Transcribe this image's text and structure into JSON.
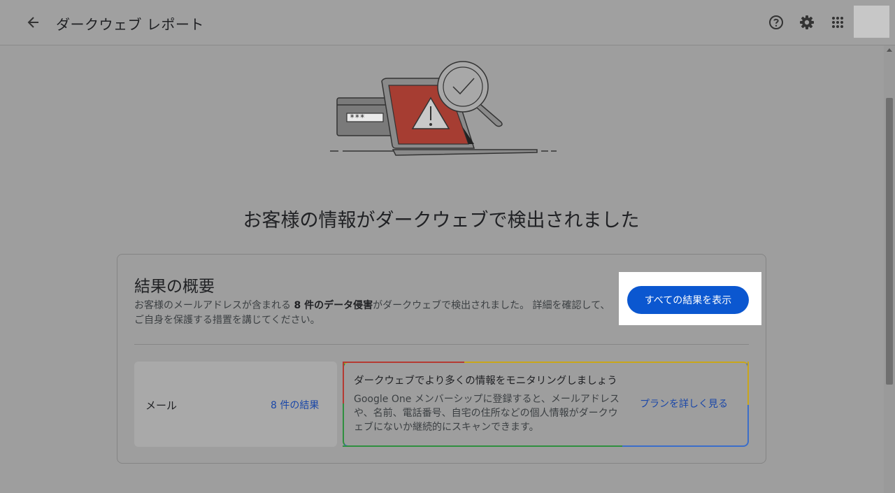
{
  "header": {
    "title": "ダークウェブ レポート",
    "icons": [
      "back-arrow-icon",
      "help-icon",
      "settings-gear-icon",
      "apps-grid-icon"
    ]
  },
  "main": {
    "headline": "お客様の情報がダークウェブで検出されました",
    "summary": {
      "title": "結果の概要",
      "desc_pre": "お客様のメールアドレスが含まれる",
      "desc_bold": "8 件のデータ侵害",
      "desc_post": "がダークウェブで検出されました。 詳細を確認して、ご自身を保護する措置を講じてください。",
      "button_label": "すべての結果を表示"
    },
    "mail": {
      "label": "メール",
      "link": "8 件の結果"
    },
    "promo": {
      "title": "ダークウェブでより多くの情報をモニタリングしましょう",
      "body": "Google One メンバーシップに登録すると、メールアドレスや、名前、電話番号、自宅の住所などの個人情報がダークウェブにないか継続的にスキャンできます。",
      "link": "プランを詳しく見る"
    },
    "illustration": {
      "password_mask": "***"
    }
  },
  "colors": {
    "primary": "#0b57d0",
    "link": "#1a47a8",
    "alert_red": "#a63d32"
  }
}
